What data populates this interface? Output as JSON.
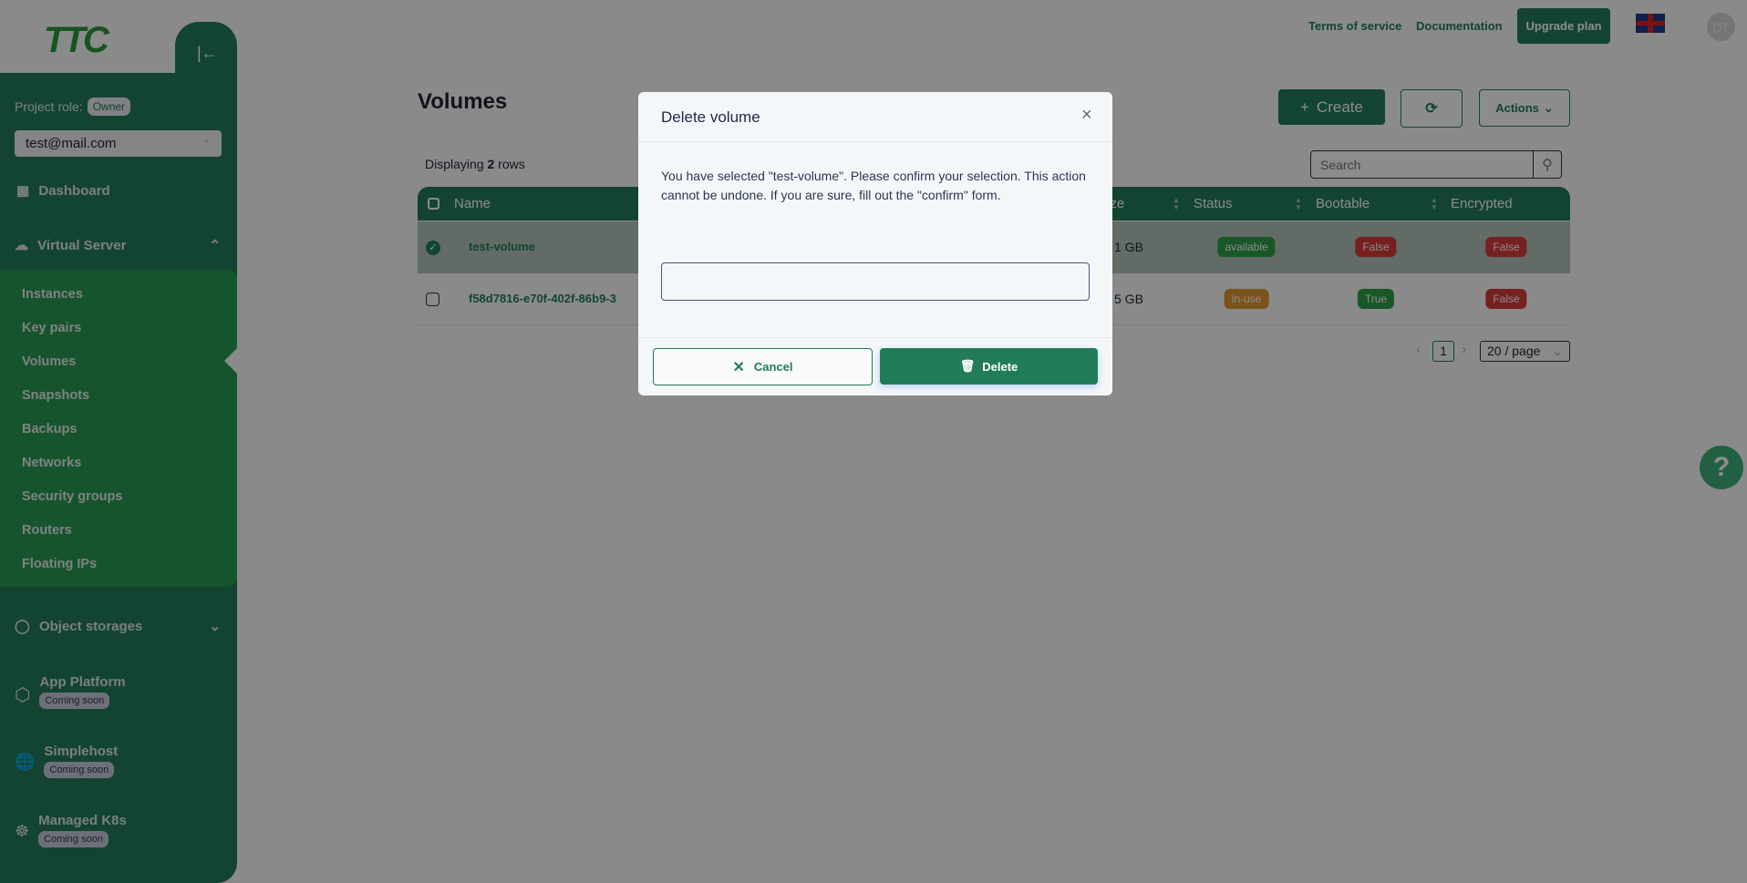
{
  "sidebar": {
    "logo": "TTC",
    "project_role_label": "Project role:",
    "project_role": "Owner",
    "account": "test@mail.com",
    "dashboard": "Dashboard",
    "virtual_server": "Virtual Server",
    "sub_items": [
      "Instances",
      "Key pairs",
      "Volumes",
      "Snapshots",
      "Backups",
      "Networks",
      "Security groups",
      "Routers",
      "Floating IPs"
    ],
    "object_storages": "Object storages",
    "app_platform": "App Platform",
    "simplehost": "Simplehost",
    "managed_k8s": "Managed K8s",
    "coming_soon": "Coming soon"
  },
  "header": {
    "terms": "Terms of service",
    "docs": "Documentation",
    "upgrade": "Upgrade plan",
    "avatar": "DT"
  },
  "main": {
    "title": "Volumes",
    "create": "Create",
    "actions": "Actions",
    "displaying_prefix": "Displaying",
    "row_count": "2",
    "displaying_suffix": "rows",
    "search_placeholder": "Search",
    "columns": [
      "Name",
      "Size",
      "Status",
      "Bootable",
      "Encrypted"
    ],
    "rows": [
      {
        "name": "test-volume",
        "size": "1 GB",
        "status": "available",
        "bootable": "False",
        "encrypted": "False",
        "selected": true
      },
      {
        "name": "f58d7816-e70f-402f-86b9-3",
        "size": "5 GB",
        "status": "in-use",
        "bootable": "True",
        "encrypted": "False",
        "selected": false
      }
    ],
    "page": "1",
    "page_size": "20 / page"
  },
  "modal": {
    "title": "Delete volume",
    "message": "You have selected \"test-volume\". Please confirm your selection. This action cannot be undone. If you are sure, fill out the \"confirm\" form.",
    "input_value": "",
    "cancel": "Cancel",
    "delete": "Delete"
  },
  "colors": {
    "brand": "#237c59",
    "available": "#2e9e4a",
    "in_use": "#e0962e",
    "false": "#d93b3b",
    "true": "#2e9e4a"
  }
}
